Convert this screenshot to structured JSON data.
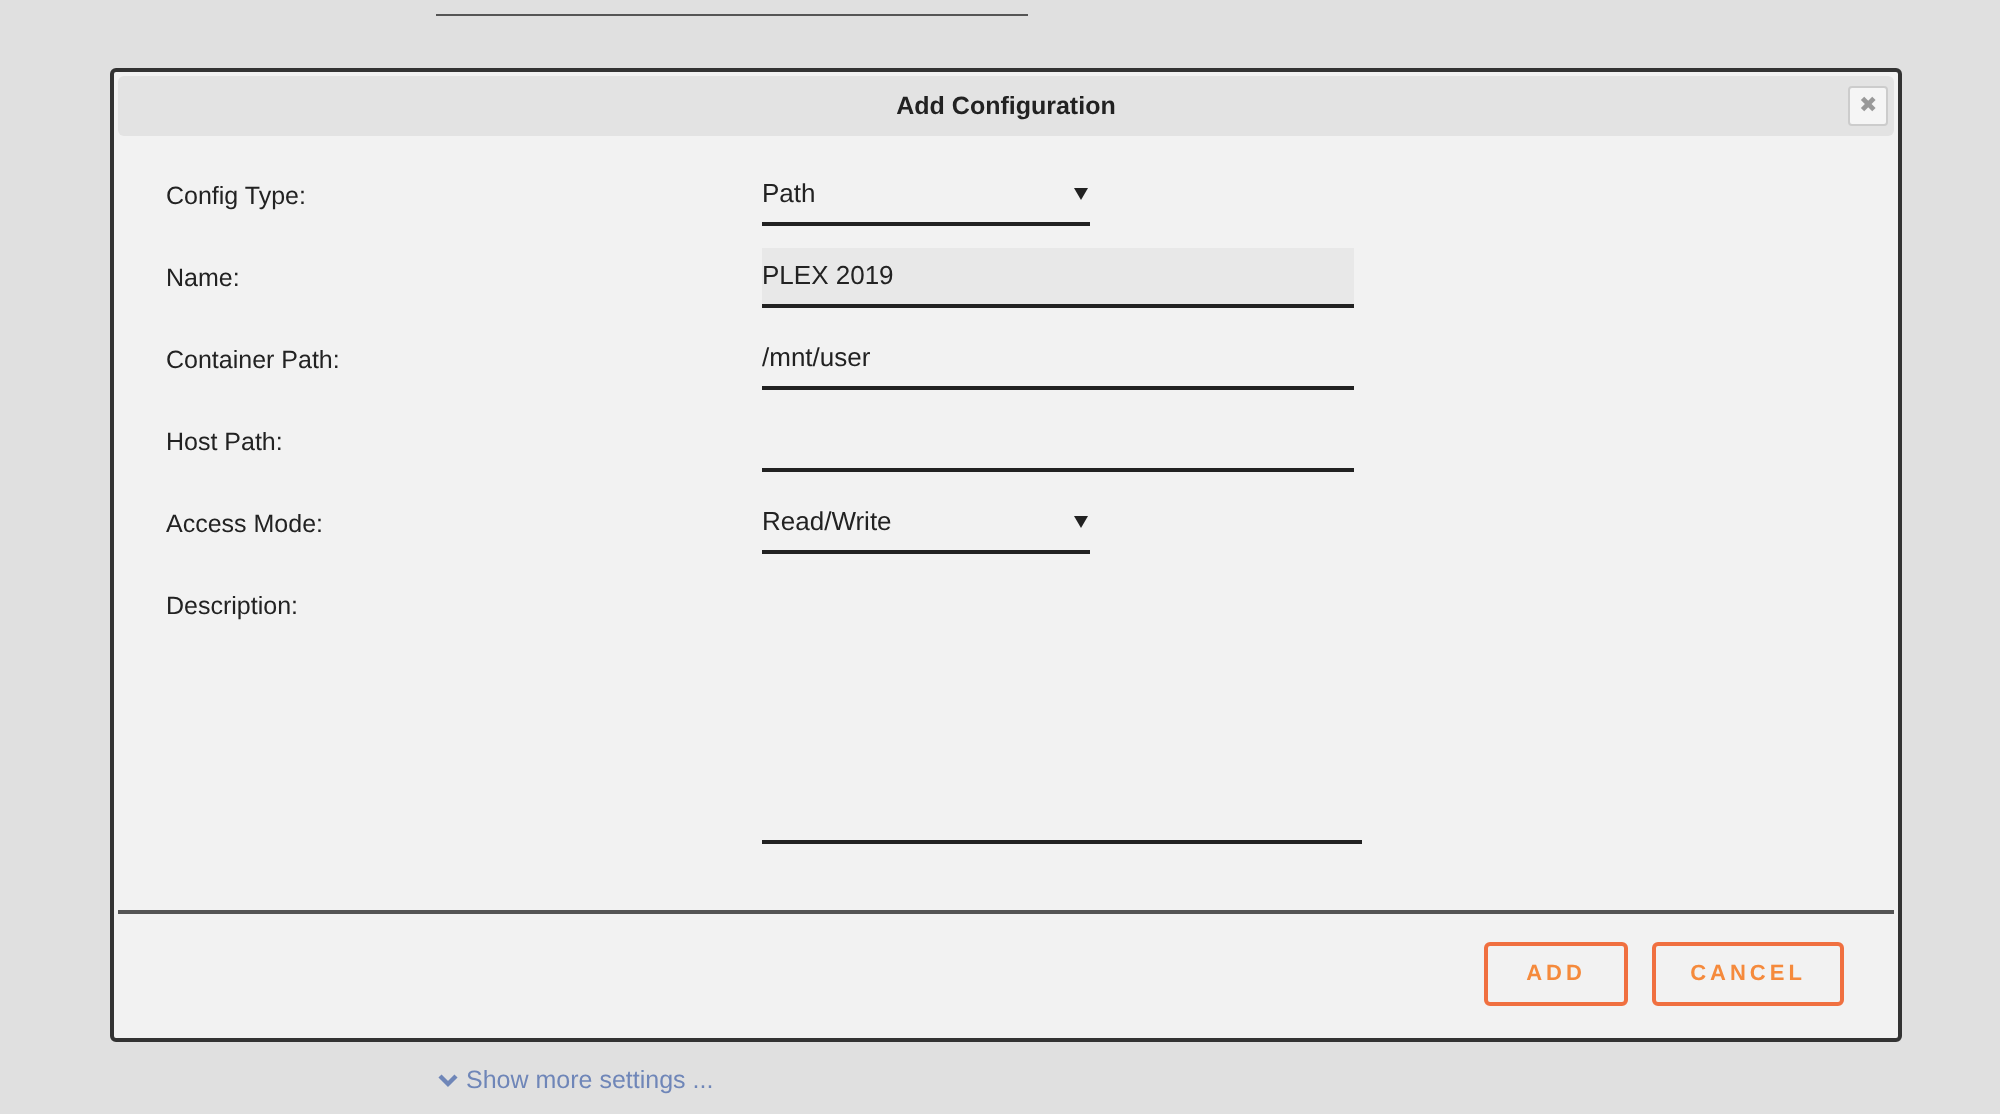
{
  "dialog": {
    "title": "Add Configuration",
    "close_icon": "✖"
  },
  "fields": [
    {
      "label": "Config Type:",
      "kind": "select",
      "value": "Path"
    },
    {
      "label": "Name:",
      "kind": "filled",
      "value": "PLEX 2019"
    },
    {
      "label": "Container Path:",
      "kind": "text",
      "value": "/mnt/user"
    },
    {
      "label": "Host Path:",
      "kind": "text"
    },
    {
      "label": "Access Mode:",
      "kind": "select",
      "value": "Read/Write"
    },
    {
      "label": "Description:",
      "kind": "textarea"
    }
  ],
  "buttons": [
    "ADD",
    "CANCEL"
  ],
  "show_more": "Show more settings ..."
}
